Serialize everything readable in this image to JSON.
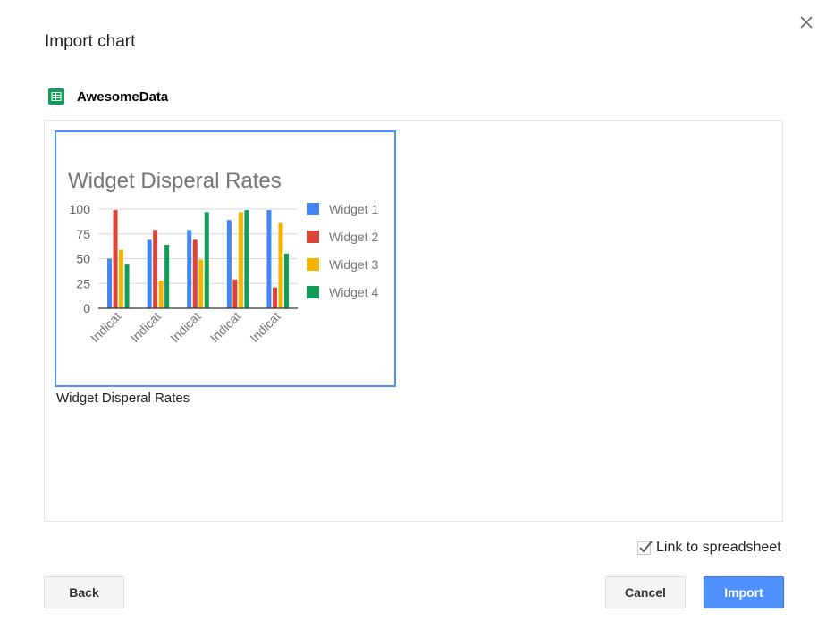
{
  "dialog": {
    "title": "Import chart",
    "close_icon": "close-icon"
  },
  "source": {
    "icon": "google-sheets-icon",
    "icon_color": "#0f9d58",
    "name": "AwesomeData"
  },
  "chart_caption": "Widget Disperal Rates",
  "chart_data": {
    "type": "bar",
    "title": "Widget Disperal Rates",
    "xlabel": "",
    "ylabel": "",
    "categories": [
      "Indicat",
      "Indicat",
      "Indicat",
      "Indicat",
      "Indicat"
    ],
    "yticks": [
      "0",
      "25",
      "50",
      "75",
      "100"
    ],
    "ylim": [
      0,
      100
    ],
    "legend_position": "right",
    "grid": true,
    "series": [
      {
        "name": "Widget 1",
        "color": "#4285f4",
        "values": [
          50,
          69,
          79,
          89,
          99
        ]
      },
      {
        "name": "Widget 2",
        "color": "#db4437",
        "values": [
          99,
          79,
          69,
          29,
          21
        ]
      },
      {
        "name": "Widget 3",
        "color": "#f4b400",
        "values": [
          59,
          28,
          49,
          97,
          86
        ]
      },
      {
        "name": "Widget 4",
        "color": "#0f9d58",
        "values": [
          44,
          64,
          97,
          99,
          55
        ]
      }
    ]
  },
  "link": {
    "label": "Link to spreadsheet",
    "checked": true
  },
  "buttons": {
    "back": "Back",
    "cancel": "Cancel",
    "import": "Import",
    "import_color": "#4d90fe"
  }
}
